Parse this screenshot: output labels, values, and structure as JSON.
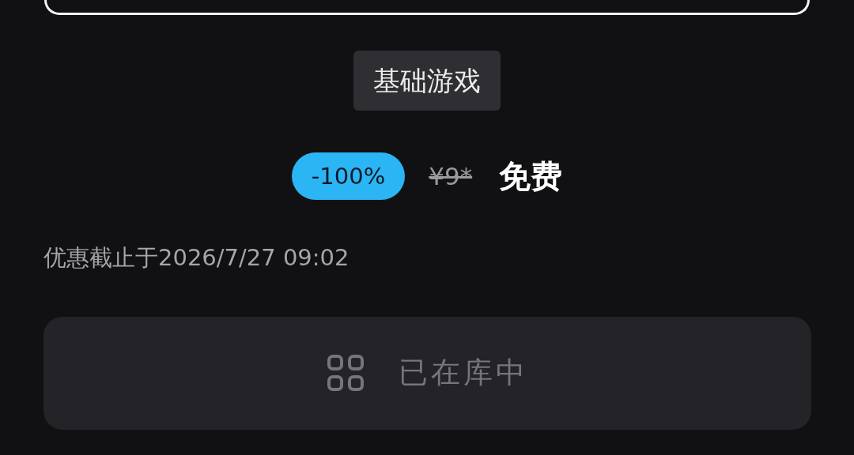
{
  "tag": "基础游戏",
  "price": {
    "discount": "-100%",
    "original": "¥9*",
    "final": "免费"
  },
  "deadline": "优惠截止于2026/7/27 09:02",
  "library_button": {
    "label": "已在库中",
    "disabled": true
  }
}
